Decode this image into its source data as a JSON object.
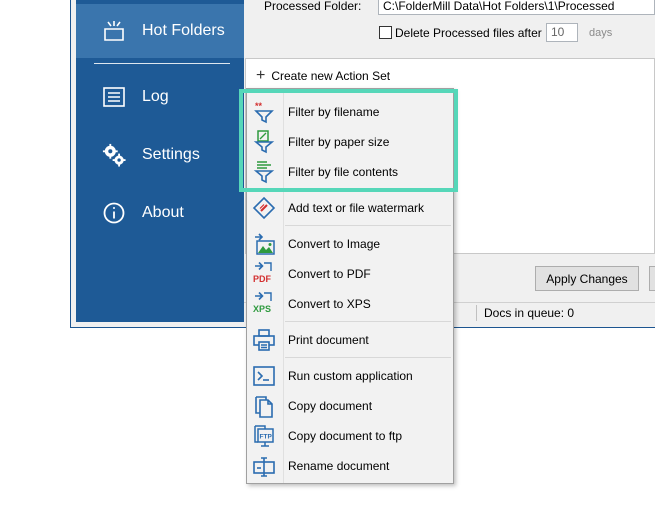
{
  "sidebar": {
    "items": [
      {
        "label": "Hot Folders",
        "icon": "hot-folder-icon",
        "active": true
      },
      {
        "label": "Log",
        "icon": "log-list-icon"
      },
      {
        "label": "Settings",
        "icon": "gears-icon"
      },
      {
        "label": "About",
        "icon": "info-icon"
      }
    ]
  },
  "main": {
    "processed_folder_label": "Processed Folder:",
    "processed_folder_value": "C:\\FolderMill Data\\Hot Folders\\1\\Processed",
    "delete_processed_label": "Delete Processed files after",
    "delete_days_value": "10",
    "days_label": "days",
    "create_action_set": "Create new Action Set",
    "apply_changes": "Apply Changes",
    "docs_in_queue": "Docs in queue: 0"
  },
  "menu": {
    "items": [
      {
        "label": "Filter by filename",
        "icon": "filter-filename-icon"
      },
      {
        "label": "Filter by paper size",
        "icon": "filter-paper-size-icon"
      },
      {
        "label": "Filter by file contents",
        "icon": "filter-file-contents-icon"
      },
      {
        "label": "Add text or file watermark",
        "icon": "watermark-icon"
      },
      {
        "label": "Convert to Image",
        "icon": "convert-image-icon"
      },
      {
        "label": "Convert to PDF",
        "icon": "convert-pdf-icon",
        "icon_text": "PDF"
      },
      {
        "label": "Convert to XPS",
        "icon": "convert-xps-icon",
        "icon_text": "XPS"
      },
      {
        "label": "Print document",
        "icon": "printer-icon"
      },
      {
        "label": "Run custom application",
        "icon": "terminal-icon"
      },
      {
        "label": "Copy document",
        "icon": "copy-document-icon"
      },
      {
        "label": "Copy document to ftp",
        "icon": "copy-ftp-icon",
        "icon_text": "FTP"
      },
      {
        "label": "Rename document",
        "icon": "rename-icon"
      }
    ]
  },
  "colors": {
    "sidebar": "#1e5a96",
    "sidebar_active": "#3a75ad",
    "highlight": "#56d7b9",
    "icon_blue": "#2b6cb0",
    "icon_red": "#d32f2f",
    "icon_green": "#2e9a3e"
  }
}
